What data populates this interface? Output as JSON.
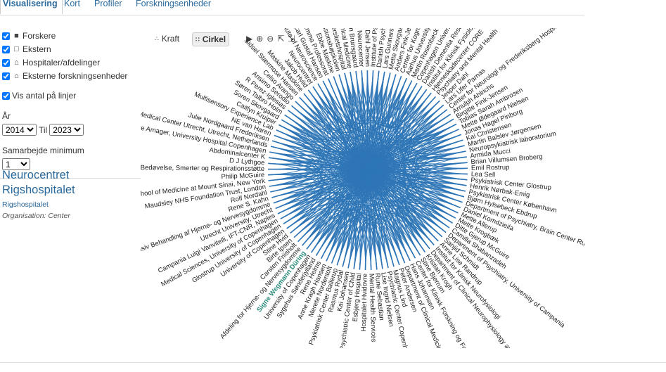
{
  "tabs": [
    "Visualisering",
    "Kort",
    "Profiler",
    "Forskningsenheder"
  ],
  "filters": [
    {
      "label": "Forskere",
      "icon": "person-icon",
      "checked": true
    },
    {
      "label": "Ekstern",
      "icon": "person-outline-icon",
      "checked": true
    },
    {
      "label": "Hospitaler/afdelinger",
      "icon": "house-icon",
      "checked": true
    },
    {
      "label": "Eksterne forskningsenheder",
      "icon": "house-outline-icon",
      "checked": true
    }
  ],
  "show_count": {
    "label": "Vis antal på linjer",
    "checked": true
  },
  "year": {
    "label": "År",
    "from": "2014",
    "separator": "Til",
    "to": "2023"
  },
  "collab": {
    "label": "Samarbejde minimum",
    "value": "1"
  },
  "org": {
    "title": "Neurocentret Rigshospitalet",
    "link": "Rigshospitalet",
    "type": "Organisation: Center"
  },
  "toolbar": {
    "force_label": "Kraft",
    "circle_label": "Cirkel"
  },
  "graph": {
    "edge_color": "#2e75b6",
    "highlight_color": "#2a8a7a",
    "highlight_label": "Signe Wegmann Düring",
    "nodes": [
      "Ebbe Maskine",
      "Professionshøjskolen",
      "Aarhus Universitetshospital",
      "Institute of Clinical Medicine",
      "Jonathan Brunsgaard",
      "Neurocenter",
      "Jakob Dahl Jensen",
      "Institute of Psychiatry",
      "Danish Psychiatric Research",
      "Lars Gunnarsen",
      "Mette Skovgaard",
      "Anders Fink-Jensen",
      "Center for Kognition",
      "Aarhus University Hospital",
      "Martin Rosenbeck",
      "Copenhagen University Hospital",
      "Danish Dementia Research Centre",
      "Institut for Klinisk Fysiologi og Nuklearmedicin",
      "Hjerneskadecenter CORE",
      "Psychiatry and Mental Health",
      "Jesper Dahl",
      "Lars Ufer Parnas",
      "Center for Neurologi og Frederiksberg Hospital",
      "Arnulph Ahlrichs",
      "Birgitte Fink-Jensen",
      "Tobias Sarah Ambrosen",
      "Mette Ødegaard Nielsen",
      "Jonas Hagel Pinborg",
      "Kai Christensen",
      "Martin Balslev Jørgensen",
      "Neuropsykiatrisk laboratorium",
      "Armida Mucci",
      "Brian Villumsen Broberg",
      "Emil Rostrup",
      "Lea Sell",
      "Psykiatrisk Center Glostrup",
      "Henrik Nørbak-Emig",
      "Psykiatrisk Center København",
      "Bjørn Hylsebeck Ebdrup",
      "Department of Psychiatry, Brain Center Rudolf Magnus",
      "Daniel Komdzieila",
      "Mette Allerup",
      "Mette Krogbæk",
      "Ditte Gjerup McGuire",
      "Camilla Shabanzadeh",
      "Department of Psychiatry, University of Campania",
      "Sanjid Schmidt",
      "Anne Lise Randrup",
      "Institut for Klinisk Neurofysiologi",
      "Department of Clinical Neurophysiology and MEG Center",
      "Kristian Krogh",
      "Stine Bjerrum",
      "Center for Klinisk Forskning og Forebyggelse",
      "Hans Johannsen",
      "Department of Clinical Medicine, Faculty",
      "Peter Andersen",
      "Magnus Lind",
      "Psychiatric Center Copenhagen",
      "Lise Ingrid Nielsen",
      "Rune Sebastian",
      "Mental Health Services",
      "Hospitalet Hvidovre",
      "Esbjerg Hospital",
      "Psychiatric Center of Child",
      "Kai Johansen",
      "Rasmus Rydal",
      "Psykiatrisk Center Ballerup",
      "Merete Nordentoft",
      "Anne Kragh Hansen",
      "Rene Helms",
      "Sygehus Sønderjylland",
      "University of Copenhagen",
      "Signe Wegmann Düring",
      "Afdeling for Hjerne- og Nervesygdomme",
      "Carsten Friisholt",
      "Birte Ipsen",
      "Stine Hvid",
      "University of Copenhagen",
      "Glostrup University of Copenhagen",
      "Medical Sciences, University of Copenhagen",
      "Campania Luigi Vanvitelli, IFT-CNR, Naples",
      "Utrecht University, Utrecht",
      "Intensiv Behandling af Hjerne- og Nervesygdomme",
      "Rene S. Kahn",
      "Rolf Nordahl",
      "Maudsley NHS Foundation Trust, London",
      "School of Medicine at Mount Sinai, New York",
      "Philip McGuire",
      "Center for Bedøvelse, Smerter og Respirationsstøtte",
      "D J Lythgoe",
      "Abdominalcenter K",
      "Hvidovre Amager, University Hospital Copenhagen",
      "Medical Center Utrecht, Utrecht, Netherlands",
      "Julie Nordgaard Frederiksen",
      "NE van Haren",
      "Multisensory Experience Lab",
      "Caitlyn Kruiper",
      "Soren Skovgaard",
      "Søren Talbro Holm",
      "R Perez-Iglesias",
      "Ansimo Serodio",
      "Celso Arango",
      "Sidsel Stærmose Hansen",
      "Maskine Maskine",
      "Jakob Hviid",
      "Neurocentret",
      "Institute of Neuroscience",
      "Carl Gustaf Hansen",
      "Emma Professorat"
    ]
  }
}
